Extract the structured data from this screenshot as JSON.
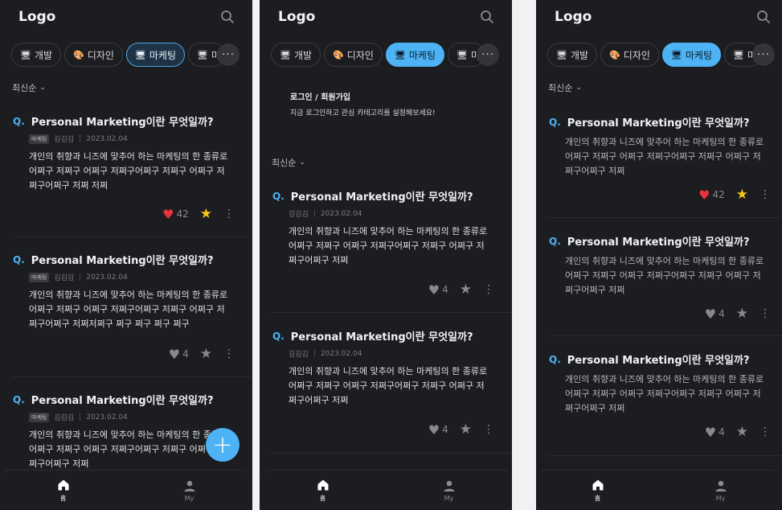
{
  "header": {
    "logo": "Logo"
  },
  "chips": {
    "dev": "개발",
    "design": "디자인",
    "marketing": "마케팅",
    "cut": "마",
    "more": "···"
  },
  "sort": {
    "label": "최신순"
  },
  "question": {
    "q": "Q.",
    "title": "Personal Marketing이란 무엇일까?",
    "tag": "마케팅",
    "author": "김김김",
    "date": "2023.02.04",
    "sep": "|",
    "body_a": "개인의 취향과 니즈에 맞추어 하는 마케팅의 한 종류로 어쩌구 저쩌구 어쩌구 저쩌구어쩌구 저쩌구 어쩌구 저쩌구어쩌구 저쩌 저쩌",
    "body_b": "개인의 취향과 니즈에 맞추어 하는 마케팅의 한 종류로 어쩌구 저쩌구 어쩌구 저쩌구어쩌구 저쩌구 어쩌구 저쩌구어쩌구 저쩌저쩌구 쩌구 쩌구 쩌구 쩌구",
    "body_c": "개인의 취향과 니즈에 맞추어 하는 마케팅의 한 종류로 어쩌구 저쩌구 어쩌구 저쩌구어쩌구 저쩌구 어쩌구 저쩌구어쩌구 저쩌",
    "likes_hot": "42",
    "likes": "4"
  },
  "login": {
    "title": "로그인 / 회원가입",
    "desc": "지금 로그인하고 관심 카테고리를 설정해보세요!"
  },
  "fab": {
    "label": "+"
  },
  "tabbar": {
    "home": "홈",
    "my": "My"
  },
  "colors": {
    "accent": "#4db3f5",
    "like": "#e8353b",
    "star": "#f5c518",
    "bg": "#1c1d20"
  },
  "icons": [
    "search-icon",
    "monitor-icon",
    "palette-icon",
    "heart-icon",
    "star-icon",
    "kebab-icon",
    "home-icon",
    "person-icon",
    "plus-icon",
    "chevron-down-icon"
  ]
}
